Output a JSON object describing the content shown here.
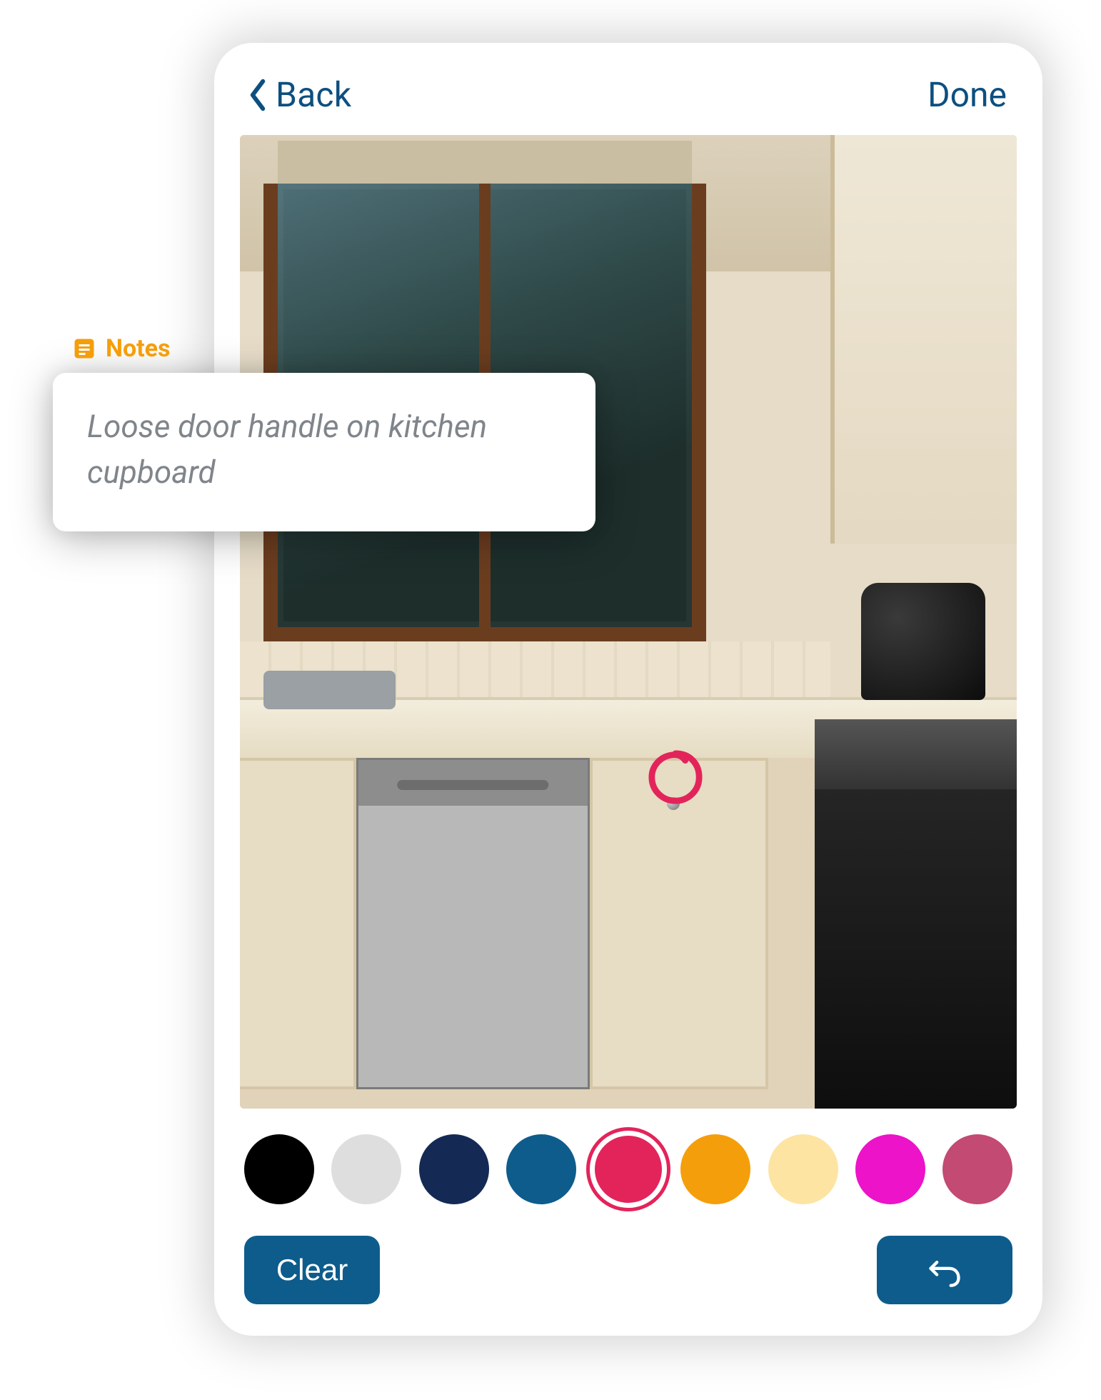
{
  "header": {
    "back_label": "Back",
    "done_label": "Done"
  },
  "notes": {
    "tab_label": "Notes",
    "text": "Loose door handle on kitchen cupboard"
  },
  "annotation": {
    "color": "#e3245a"
  },
  "palette": {
    "selected_index": 4,
    "colors": [
      "#000000",
      "#dedede",
      "#142a55",
      "#0d5c8c",
      "#e3245a",
      "#f59e0b",
      "#fde4a2",
      "#ec13c9",
      "#c24a73"
    ]
  },
  "actions": {
    "clear_label": "Clear"
  }
}
